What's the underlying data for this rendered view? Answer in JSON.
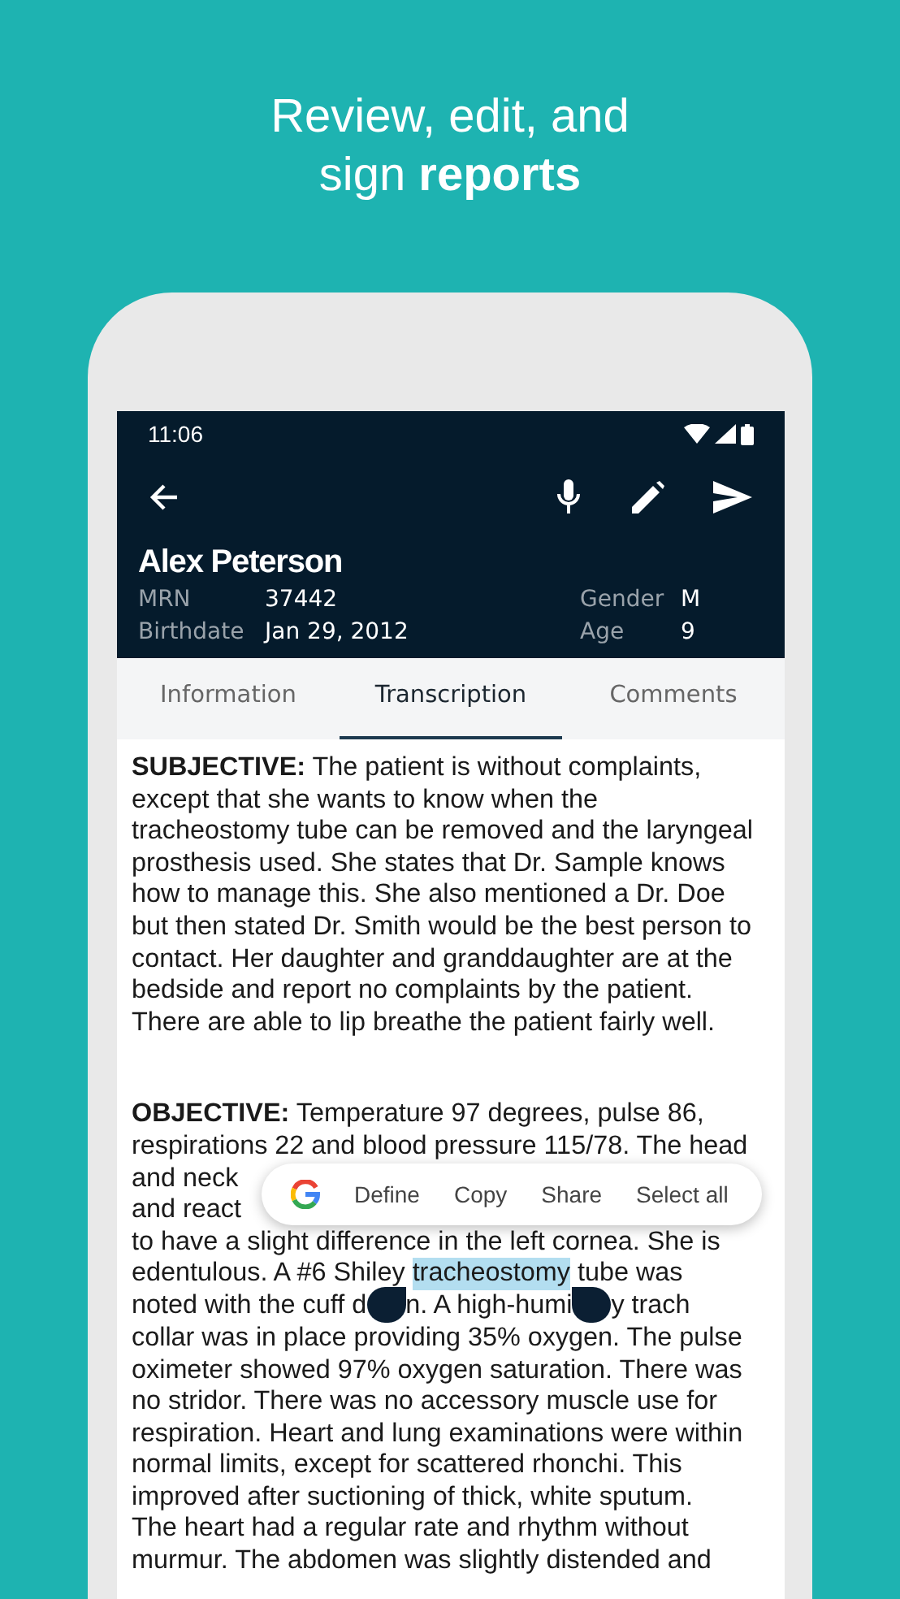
{
  "headline": [
    "Review, edit, and",
    "sign **reports**"
  ],
  "status_bar": {
    "time": "11:06"
  },
  "patient": {
    "name": "Alex Peterson",
    "left_fields": [
      {
        "label": "MRN",
        "value": "37442"
      },
      {
        "label": "Birthdate",
        "value": "Jan 29, 2012"
      }
    ],
    "right_fields": [
      {
        "label": "Gender",
        "value": "M"
      },
      {
        "label": "Age",
        "value": "9"
      }
    ]
  },
  "tabs": [
    {
      "label": "Information",
      "selected": false
    },
    {
      "label": "Transcription",
      "selected": true
    },
    {
      "label": "Comments",
      "selected": false
    }
  ],
  "sections": [
    {
      "lines": [
        {
          "kind": "text",
          "text": "**SUBJECTIVE:** The patient is without complaints,"
        },
        {
          "kind": "text",
          "text": "except that she wants to know when the"
        },
        {
          "kind": "text",
          "text": "tracheostomy tube can be removed and the laryngeal"
        },
        {
          "kind": "text",
          "text": "prosthesis used. She states that Dr. Sample knows"
        },
        {
          "kind": "text",
          "text": "how to manage this. She also mentioned a Dr. Doe"
        },
        {
          "kind": "text",
          "text": "but then stated Dr. Smith would be the best person to"
        },
        {
          "kind": "text",
          "text": "contact. Her daughter and granddaughter are at the"
        },
        {
          "kind": "text",
          "text": "bedside and report no complaints by the patient."
        },
        {
          "kind": "text",
          "text": "There are able to lip breathe the patient fairly well."
        }
      ]
    },
    {
      "lines": [
        {
          "kind": "text",
          "text": "**OBJECTIVE:** Temperature 97 degrees, pulse 86,"
        },
        {
          "kind": "text",
          "text": "respirations 22 and blood pressure 115/78. The head"
        },
        {
          "kind": "text",
          "text": "and neck"
        },
        {
          "kind": "text",
          "text": "and react"
        },
        {
          "kind": "text",
          "text": "to have a slight difference in the left cornea. She is"
        },
        {
          "kind": "selection",
          "before": "edentulous. A #6 Shiley ",
          "selected": "tracheostomy",
          "after": " tube was"
        },
        {
          "kind": "handles",
          "segments": [
            "noted with the cuff d",
            "n. A high-humi",
            "y trach"
          ]
        },
        {
          "kind": "text",
          "text": "collar was in place providing 35% oxygen. The pulse"
        },
        {
          "kind": "text",
          "text": "oximeter showed 97% oxygen saturation. There was"
        },
        {
          "kind": "text",
          "text": "no stridor. There was no accessory muscle use for"
        },
        {
          "kind": "text",
          "text": "respiration. Heart and lung examinations were within"
        },
        {
          "kind": "text",
          "text": "normal limits, except for scattered rhonchi. This"
        },
        {
          "kind": "text",
          "text": "improved after suctioning of thick, white sputum."
        },
        {
          "kind": "text",
          "text": "The heart had a regular rate and rhythm without"
        },
        {
          "kind": "text",
          "text": "murmur. The abdomen was slightly distended and"
        }
      ]
    }
  ],
  "text_menu": {
    "items": [
      "Define",
      "Copy",
      "Share",
      "Select all"
    ]
  }
}
